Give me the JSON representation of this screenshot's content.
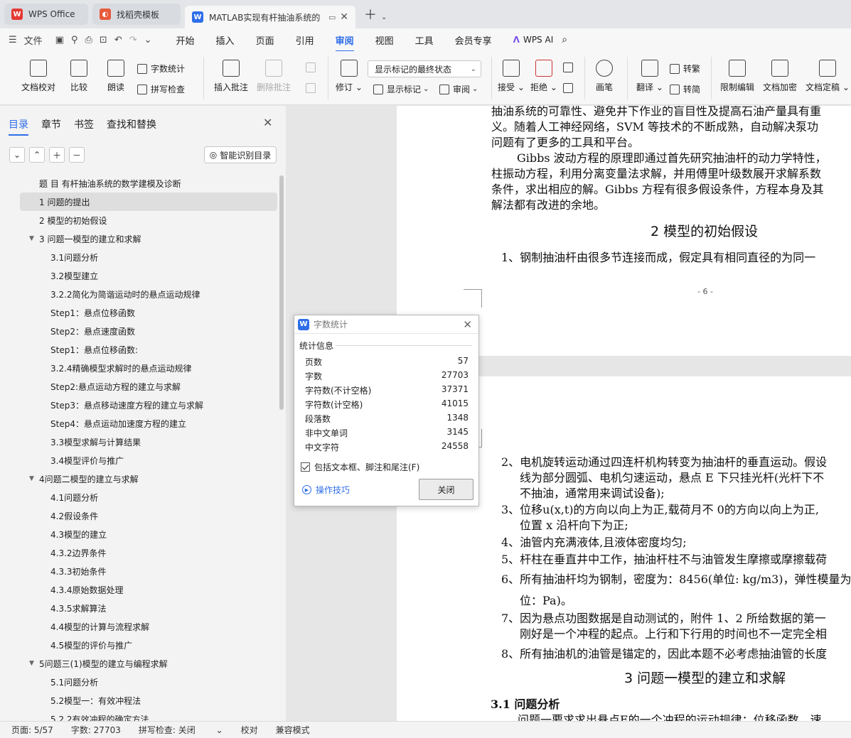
{
  "tabs": [
    {
      "label": "WPS Office",
      "icon": "wps-logo-icon"
    },
    {
      "label": "找稻壳模板",
      "icon": "template-icon"
    },
    {
      "label": "MATLAB实现有杆抽油系统的",
      "icon": "doc-icon"
    }
  ],
  "menu": {
    "file": "文件",
    "items": [
      "开始",
      "插入",
      "页面",
      "引用",
      "审阅",
      "视图",
      "工具",
      "会员专享"
    ],
    "active": "审阅",
    "wps_ai": "WPS AI"
  },
  "ribbon": {
    "doc_check": "文档校对",
    "compare": "比较",
    "read_aloud": "朗读",
    "word_count": "字数统计",
    "spell_check": "拼写检查",
    "insert_comment": "插入批注",
    "delete_comment": "删除批注",
    "revise": "修订",
    "markup_state": "显示标记的最终状态",
    "show_markup": "显示标记",
    "review": "审阅",
    "accept": "接受",
    "reject": "拒绝",
    "pen": "画笔",
    "translate": "翻译",
    "to_traditional": "转繁",
    "to_simplified": "转简",
    "restrict_edit": "限制编辑",
    "doc_encrypt": "文档加密",
    "doc_finalize": "文档定稿"
  },
  "nav": {
    "tabs": [
      "目录",
      "章节",
      "书签",
      "查找和替换"
    ],
    "smart_toc": "智能识别目录",
    "toc": [
      {
        "label": "题 目 有杆抽油系统的数学建模及诊断",
        "level": 0
      },
      {
        "label": "1  问题的提出",
        "level": 0,
        "selected": true
      },
      {
        "label": "2 模型的初始假设",
        "level": 0
      },
      {
        "label": "3 问题一模型的建立和求解",
        "level": 0,
        "expanded": true
      },
      {
        "label": "3.1问题分析",
        "level": 1
      },
      {
        "label": "3.2模型建立",
        "level": 1
      },
      {
        "label": "3.2.2简化为简谐运动时的悬点运动规律",
        "level": 1
      },
      {
        "label": "Step1：悬点位移函数",
        "level": 1
      },
      {
        "label": "Step2：悬点速度函数",
        "level": 1
      },
      {
        "label": "Step1：悬点位移函数:",
        "level": 1
      },
      {
        "label": "3.2.4精确模型求解时的悬点运动规律",
        "level": 1
      },
      {
        "label": "Step2:悬点运动方程的建立与求解",
        "level": 1
      },
      {
        "label": "Step3：悬点移动速度方程的建立与求解",
        "level": 1
      },
      {
        "label": "Step4：悬点运动加速度方程的建立",
        "level": 1
      },
      {
        "label": "3.3模型求解与计算结果",
        "level": 1
      },
      {
        "label": "3.4模型评价与推广",
        "level": 1
      },
      {
        "label": "4问题二模型的建立与求解",
        "level": 0,
        "expanded": true
      },
      {
        "label": "4.1问题分析",
        "level": 1
      },
      {
        "label": "4.2假设条件",
        "level": 1
      },
      {
        "label": "4.3模型的建立",
        "level": 1
      },
      {
        "label": "4.3.2边界条件",
        "level": 1
      },
      {
        "label": "4.3.3初始条件",
        "level": 1
      },
      {
        "label": "4.3.4原始数据处理",
        "level": 1
      },
      {
        "label": "4.3.5求解算法",
        "level": 1
      },
      {
        "label": "4.4模型的计算与流程求解",
        "level": 1
      },
      {
        "label": "4.5模型的评价与推广",
        "level": 1
      },
      {
        "label": "5问题三(1)模型的建立与编程求解",
        "level": 0,
        "expanded": true
      },
      {
        "label": "5.1问题分析",
        "level": 1
      },
      {
        "label": "5.2模型一：有效冲程法",
        "level": 1
      },
      {
        "label": "5.2.2有效冲程的确定方法",
        "level": 1
      }
    ]
  },
  "document": {
    "page1_lines": [
      "抽油系统的可靠性、避免井下作业的盲目性及提高石油产量具有重",
      "义。随着人工神经网络，SVM 等技术的不断成熟，自动解决泵功",
      "问题有了更多的工具和平台。",
      "Gibbs 波动方程的原理即通过首先研究抽油杆的动力学特性，",
      "柱振动方程，利用分离变量法求解，并用傅里叶级数展开求解系数",
      "条件，求出相应的解。Gibbs 方程有很多假设条件，方程本身及其",
      "解法都有改进的余地。"
    ],
    "heading_2": "2 模型的初始假设",
    "assumption_1": "1、钢制抽油杆由很多节连接而成，假定具有相同直径的为同一",
    "page_number": "- 6 -",
    "page2_lines": [
      "2、电机旋转运动通过四连杆机构转变为抽油杆的垂直运动。假设",
      "线为部分圆弧、电机匀速运动，悬点 E 下只挂光杆(光杆下不",
      "不抽油，通常用来调试设备);",
      "3、位移u(x,t)的方向以向上为正,载荷月不 0的方向以向上为正,",
      "位置 x 沿杆向下为正;",
      "4、油管内充满液体,且液体密度均匀;",
      "5、杆柱在垂直井中工作，抽油杆柱不与油管发生摩擦或摩擦载荷",
      "6、所有抽油杆均为钢制，密度为：8456(单位: kg/m3)，弹性模量为",
      "位：Pa)。",
      "7、因为悬点功图数据是自动测试的，附件 1、2 所给数据的第一",
      "刚好是一个冲程的起点。上行和下行用的时间也不一定完全相",
      "8、所有抽油机的油管是锚定的，因此本题不必考虑抽油管的长度"
    ],
    "heading_3": "3 问题一模型的建立和求解",
    "heading_3_1": "3.1  问题分析",
    "last_line": "问题一要求求出悬点E的一个冲程的运动规律：位移函数、速"
  },
  "dialog": {
    "title": "字数统计",
    "group": "统计信息",
    "rows": [
      {
        "label": "页数",
        "value": "57"
      },
      {
        "label": "字数",
        "value": "27703"
      },
      {
        "label": "字符数(不计空格)",
        "value": "37371"
      },
      {
        "label": "字符数(计空格)",
        "value": "41015"
      },
      {
        "label": "段落数",
        "value": "1348"
      },
      {
        "label": "非中文单词",
        "value": "3145"
      },
      {
        "label": "中文字符",
        "value": "24558"
      }
    ],
    "include_label": "包括文本框、脚注和尾注(F)",
    "include_checked": true,
    "tips": "操作技巧",
    "close": "关闭"
  },
  "status": {
    "page": "页面: 5/57",
    "words": "字数: 27703",
    "spell": "拼写检查: 关闭",
    "proof": "校对",
    "compat": "兼容模式"
  }
}
